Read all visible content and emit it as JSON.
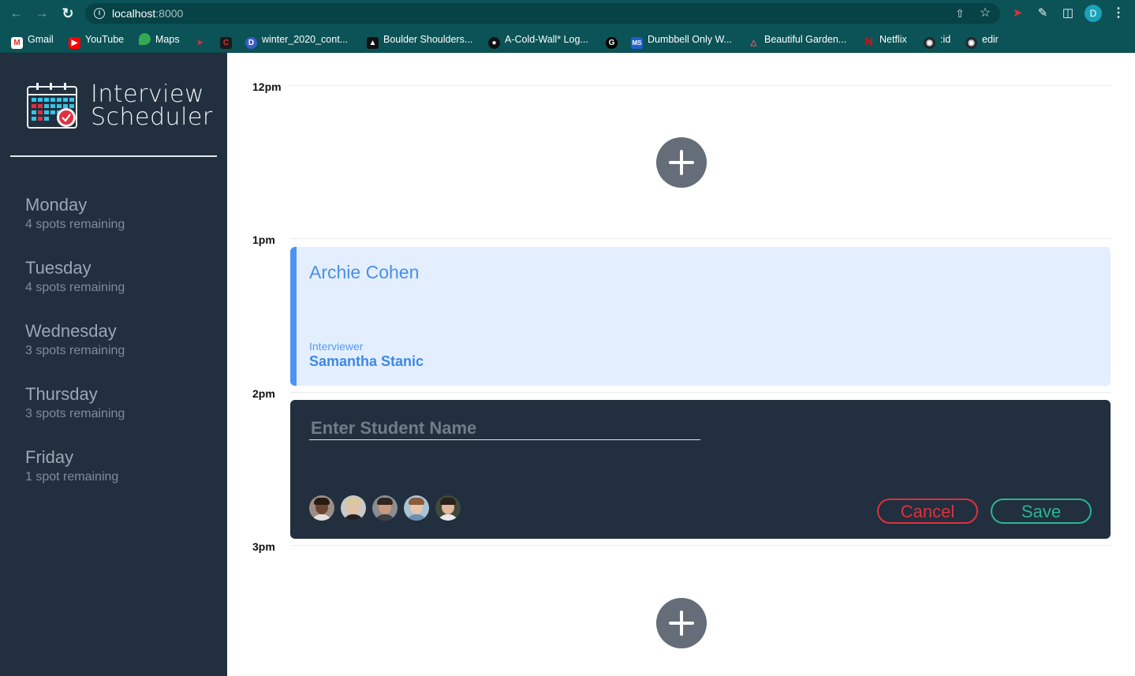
{
  "browser": {
    "url_host": "localhost",
    "url_port": ":8000",
    "profile_initial": "D",
    "bookmarks": [
      {
        "label": "Gmail",
        "icon": "gmail-icon"
      },
      {
        "label": "YouTube",
        "icon": "youtube-icon"
      },
      {
        "label": "Maps",
        "icon": "maps-icon"
      },
      {
        "label": "",
        "icon": "bird-icon"
      },
      {
        "label": "",
        "icon": "c-logo-icon"
      },
      {
        "label": "winter_2020_cont...",
        "icon": "d-logo-icon"
      },
      {
        "label": "Boulder Shoulders...",
        "icon": "shield-icon"
      },
      {
        "label": "A-Cold-Wall* Log...",
        "icon": "acw-icon"
      },
      {
        "label": "",
        "icon": "g-logo-icon"
      },
      {
        "label": "Dumbbell Only W...",
        "icon": "ms-logo-icon"
      },
      {
        "label": "Beautiful Garden...",
        "icon": "airbnb-icon"
      },
      {
        "label": "Netflix",
        "icon": "netflix-icon"
      },
      {
        "label": ":id",
        "icon": "github-icon"
      },
      {
        "label": "edir",
        "icon": "github-icon"
      }
    ]
  },
  "sidebar": {
    "logo_line1": "Interview",
    "logo_line2": "Scheduler",
    "days": [
      {
        "name": "Monday",
        "spots": "4 spots remaining"
      },
      {
        "name": "Tuesday",
        "spots": "4 spots remaining"
      },
      {
        "name": "Wednesday",
        "spots": "3 spots remaining"
      },
      {
        "name": "Thursday",
        "spots": "3 spots remaining"
      },
      {
        "name": "Friday",
        "spots": "1 spot remaining"
      }
    ]
  },
  "schedule": {
    "times": [
      "12pm",
      "1pm",
      "2pm",
      "3pm"
    ],
    "booked": {
      "student": "Archie Cohen",
      "interviewer_caption": "Interviewer",
      "interviewer": "Samantha Stanic"
    },
    "form": {
      "student_value": "",
      "student_placeholder": "Enter Student Name",
      "cancel_label": "Cancel",
      "save_label": "Save"
    }
  },
  "colors": {
    "sidebar_bg": "#222f3e",
    "booked_bg": "#e3efff",
    "booked_accent": "#4e93f1",
    "cancel": "#e0303f",
    "save": "#2bb594",
    "add_button": "#646d78"
  }
}
